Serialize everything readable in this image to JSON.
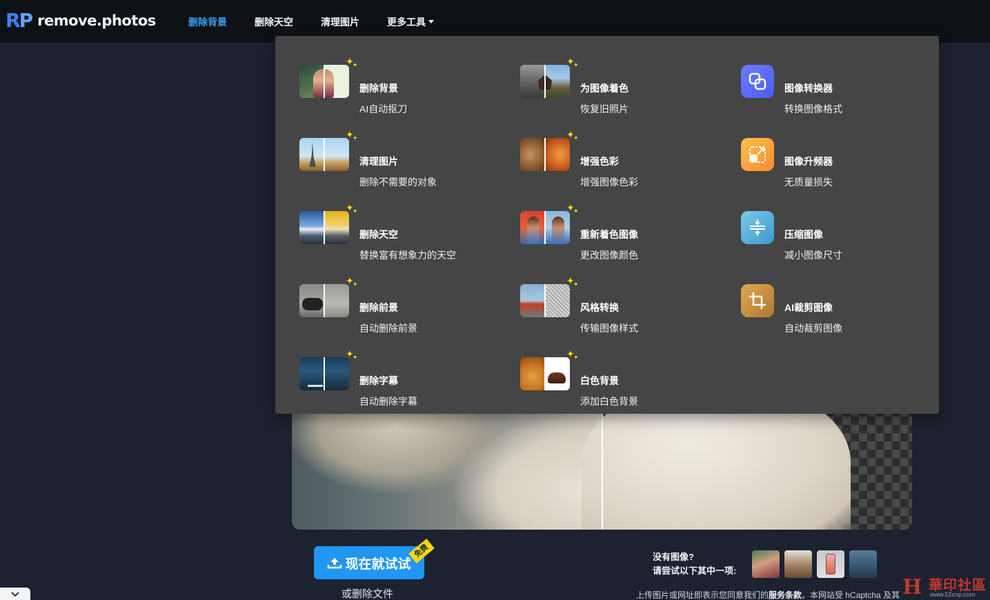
{
  "brand": {
    "mark_r": "R",
    "mark_p": "P",
    "name": "remove.photos"
  },
  "nav": {
    "items": [
      {
        "label": "删除背景",
        "active": true
      },
      {
        "label": "删除天空",
        "active": false
      },
      {
        "label": "清理图片",
        "active": false
      },
      {
        "label": "更多工具",
        "active": false
      }
    ]
  },
  "menu": {
    "items": [
      {
        "title": "删除背景",
        "subtitle": "AI自动抠刀"
      },
      {
        "title": "为图像着色",
        "subtitle": "恢复旧照片"
      },
      {
        "title": "图像转换器",
        "subtitle": "转换图像格式"
      },
      {
        "title": "清理图片",
        "subtitle": "删除不需要的对象"
      },
      {
        "title": "增强色彩",
        "subtitle": "增强图像色彩"
      },
      {
        "title": "图像升频器",
        "subtitle": "无质量损失"
      },
      {
        "title": "删除天空",
        "subtitle": "替换富有想象力的天空"
      },
      {
        "title": "重新着色图像",
        "subtitle": "更改图像颜色"
      },
      {
        "title": "压缩图像",
        "subtitle": "减小图像尺寸"
      },
      {
        "title": "删除前景",
        "subtitle": "自动删除前景"
      },
      {
        "title": "风格转换",
        "subtitle": "传输图像样式"
      },
      {
        "title": "AI裁剪图像",
        "subtitle": "自动裁剪图像"
      },
      {
        "title": "删除字幕",
        "subtitle": "自动删除字幕"
      },
      {
        "title": "白色背景",
        "subtitle": "添加白色背景"
      }
    ]
  },
  "cta": {
    "button_label": "现在就试试",
    "badge": "免费",
    "secondary": "或删除文件"
  },
  "samples_prompt": {
    "line1": "没有图像?",
    "line2": "请尝试以下其中一项:"
  },
  "legal": {
    "prefix": "上传图片或网址即表示您同意我们的",
    "terms": "服务条款",
    "suffix": "。本网站受 hCaptcha 及其"
  },
  "watermark": {
    "mark": "H",
    "text": "華印社區",
    "url": "www.52cnp.com"
  },
  "colors": {
    "accent": "#2196f3",
    "active_nav": "#3b9cf0",
    "menu_bg": "#454545",
    "page_bg": "#1c2230",
    "spark": "#f5d90a"
  }
}
